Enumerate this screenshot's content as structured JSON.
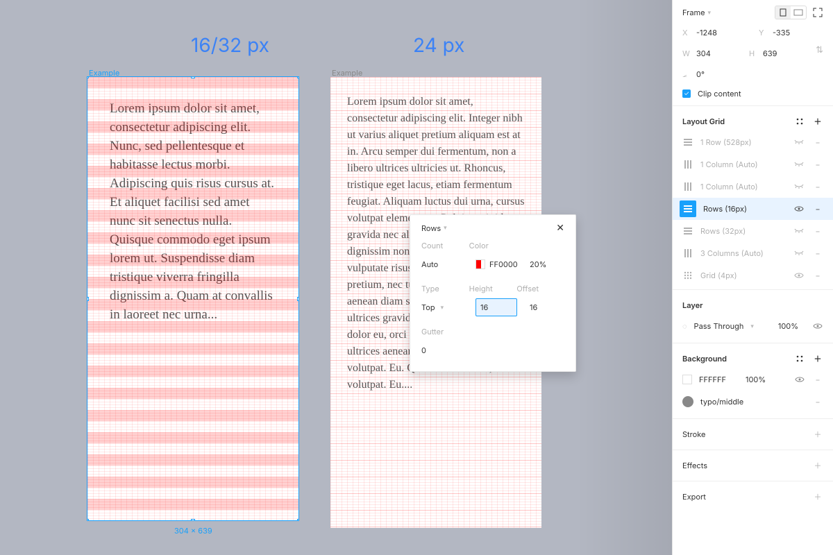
{
  "canvas": {
    "title_left": "16/32 px",
    "title_right": "24 px",
    "frame_label": "Example",
    "dimensions": "304 × 639",
    "body_text_1": "Lorem ipsum dolor sit amet, consectetur adipiscing elit. Nunc, sed pellentesque et habitasse lectus morbi. Adipiscing quis risus cursus at. Et aliquet facilisi sed amet nunc sit senectus nulla. Quisque commodo eget ipsum lorem ut. Suspendisse diam tristique viverra fringilla dignissim a. Quam at convallis in laoreet nec urna...",
    "body_text_2": "Lorem ipsum dolor sit amet, consectetur adipiscing elit. Integer nibh ut varius aliquet pretium aliquam est at in. Arcu semper dui fermentum, non a libero ultrices ultricies ut. Rhoncus, tristique eget lacus, etiam fermentum feugiat. Aliquam luctus dui urna, cursus volutpat elementum. Pulvinar sit id gravida nec aliquet et, sed non cum. Ut dignissim non suscipit bibendum vulputate risus faucibus enim viverra in pretium, nec turpis ac risus, purus aenean diam sed nam. Ornare nam ultrices gravida lacinia urna. Ipsum dolor eu, orci in fermentum euismod ultrices aenean. Quis dolor at amet, volutpat. Eu. Quis dolor at amet, volutpat. Eu...."
  },
  "panel": {
    "frame_label": "Frame",
    "x_label": "X",
    "x_val": "-1248",
    "y_label": "Y",
    "y_val": "-335",
    "w_label": "W",
    "w_val": "304",
    "h_label": "H",
    "h_val": "639",
    "angle_val": "0°",
    "clip_label": "Clip content",
    "layout_grid_title": "Layout Grid",
    "grids": [
      {
        "icon": "rows",
        "label": "1 Row (528px)",
        "visible": false
      },
      {
        "icon": "cols",
        "label": "1 Column (Auto)",
        "visible": false
      },
      {
        "icon": "cols",
        "label": "1 Column (Auto)",
        "visible": false
      },
      {
        "icon": "rows",
        "label": "Rows (16px)",
        "visible": true,
        "active": true
      },
      {
        "icon": "rows",
        "label": "Rows (32px)",
        "visible": false
      },
      {
        "icon": "cols",
        "label": "3 Columns (Auto)",
        "visible": false
      },
      {
        "icon": "grid",
        "label": "Grid (4px)",
        "visible": true
      }
    ],
    "layer_title": "Layer",
    "layer_mode": "Pass Through",
    "layer_opacity": "100%",
    "background_title": "Background",
    "bg_hex": "FFFFFF",
    "bg_opacity": "100%",
    "style_name": "typo/middle",
    "stroke_title": "Stroke",
    "effects_title": "Effects",
    "export_title": "Export"
  },
  "popup": {
    "title": "Rows",
    "count_label": "Count",
    "count_val": "Auto",
    "color_label": "Color",
    "color_hex": "FF0000",
    "color_opacity": "20%",
    "type_label": "Type",
    "type_val": "Top",
    "height_label": "Height",
    "height_val": "16",
    "offset_label": "Offset",
    "offset_val": "16",
    "gutter_label": "Gutter",
    "gutter_val": "0"
  }
}
